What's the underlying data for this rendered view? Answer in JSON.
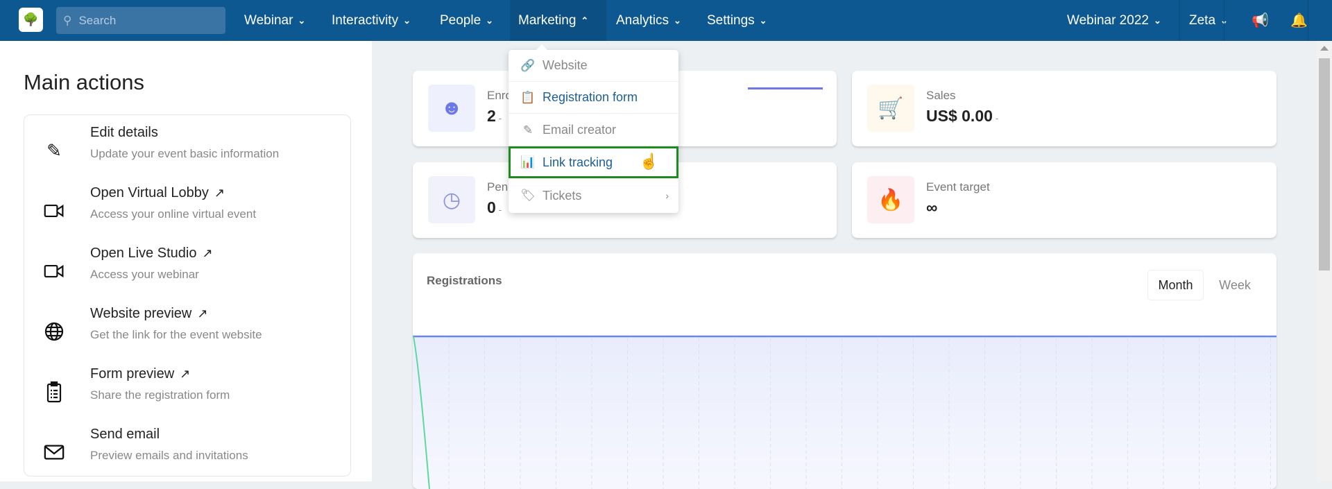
{
  "nav": {
    "search_placeholder": "Search",
    "menus": [
      {
        "label": "Webinar"
      },
      {
        "label": "Interactivity"
      },
      {
        "label": "People"
      },
      {
        "label": "Marketing"
      },
      {
        "label": "Analytics"
      },
      {
        "label": "Settings"
      }
    ],
    "event_selector": "Webinar 2022",
    "user": "Zeta",
    "icons": [
      "search-icon",
      "megaphone-icon",
      "bell-icon"
    ]
  },
  "main_actions": {
    "title": "Main actions",
    "items": [
      {
        "title": "Edit details",
        "subtitle": "Update your event basic information",
        "icon": "pencil-icon",
        "external": false
      },
      {
        "title": "Open Virtual Lobby",
        "subtitle": "Access your online virtual event",
        "icon": "video-camera-icon",
        "external": true
      },
      {
        "title": "Open Live Studio",
        "subtitle": "Access your webinar",
        "icon": "video-camera-icon",
        "external": true
      },
      {
        "title": "Website preview",
        "subtitle": "Get the link for the event website",
        "icon": "globe-icon",
        "external": true
      },
      {
        "title": "Form preview",
        "subtitle": "Share the registration form",
        "icon": "clipboard-icon",
        "external": true
      },
      {
        "title": "Send email",
        "subtitle": "Preview emails and invitations",
        "icon": "envelope-icon",
        "external": false
      }
    ]
  },
  "stats": [
    {
      "label": "Enro",
      "value": "2",
      "suffix": "-",
      "icon": "user-icon",
      "color": "#6b78e5"
    },
    {
      "label": "Sales",
      "value": "US$ 0.00",
      "suffix": "-",
      "icon": "cart-icon",
      "color": "#f0b34a"
    },
    {
      "label": "Pen",
      "value": "0",
      "suffix": "-",
      "icon": "clock-icon",
      "color": "#8b8fe0"
    },
    {
      "label": "Event target",
      "value": "∞",
      "suffix": "",
      "icon": "flame-icon",
      "color": "#f06a80"
    }
  ],
  "marketing_dropdown": {
    "items": [
      {
        "label": "Website",
        "icon": "link-icon"
      },
      {
        "label": "Registration form",
        "icon": "clipboard-list-icon"
      },
      {
        "label": "Email creator",
        "icon": "edit-icon"
      },
      {
        "label": "Link tracking",
        "icon": "chart-bar-icon",
        "highlighted": true
      },
      {
        "label": "Tickets",
        "icon": "tag-icon",
        "has_submenu": true
      }
    ]
  },
  "registrations": {
    "title": "Registrations",
    "tabs": [
      {
        "label": "Month",
        "active": true
      },
      {
        "label": "Week",
        "active": false
      }
    ],
    "colors": {
      "line": "#6b86e0",
      "secondary_line": "#5fd99a",
      "fill": "#eef0fd"
    }
  },
  "accent": "#0d5891"
}
